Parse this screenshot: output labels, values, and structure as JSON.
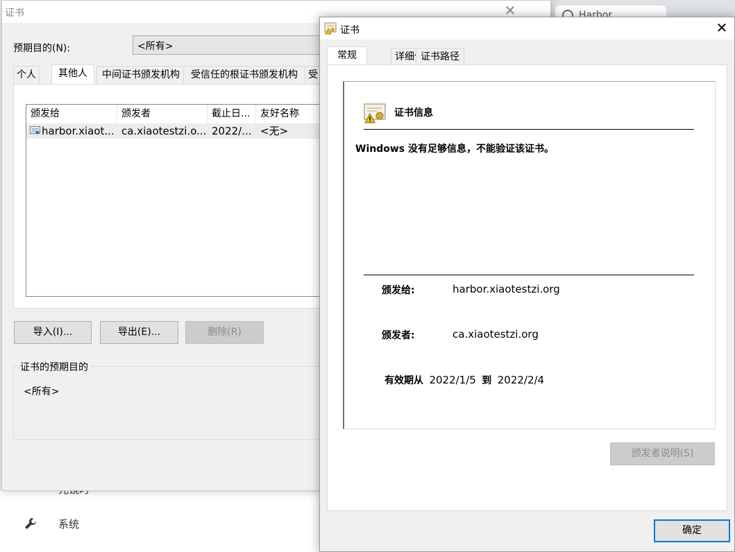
{
  "background": {
    "tabs": [
      {
        "label": "×",
        "icon": "close-icon"
      },
      {
        "label": "Harbor",
        "icon": "harbor-icon"
      }
    ],
    "partial_menu_text": "元镜时",
    "menu_system_label": "系统",
    "menu_system_icon": "wrench-icon"
  },
  "cert_manager": {
    "title": "证书",
    "close_label": "✕",
    "purpose_label": "预期目的(N):",
    "purpose_value": "<所有>",
    "tabs": [
      "个人",
      "其他人",
      "中间证书颁发机构",
      "受信任的根证书颁发机构",
      "受"
    ],
    "selected_tab": "其他人",
    "list": {
      "columns": [
        "颁发给",
        "颁发者",
        "截止日...",
        "友好名称"
      ],
      "rows": [
        {
          "issued_to": "harbor.xiaot...",
          "issued_by": "ca.xiaotestzi.o...",
          "expires": "2022/...",
          "friendly_name": "<无>"
        }
      ]
    },
    "buttons": {
      "import": "导入(I)...",
      "export": "导出(E)...",
      "remove": "删除(R)"
    },
    "purposes_group_title": "证书的预期目的",
    "purposes_value": "<所有>"
  },
  "cert_dialog": {
    "title": "证书",
    "close_label": "✕",
    "tabs": [
      "常规",
      "详细信息",
      "证书路径"
    ],
    "selected_tab": "常规",
    "info_title": "证书信息",
    "warning": "Windows 没有足够信息，不能验证该证书。",
    "issued_to_label": "颁发给:",
    "issued_to_value": "harbor.xiaotestzi.org",
    "issued_by_label": "颁发者:",
    "issued_by_value": "ca.xiaotestzi.org",
    "valid_from_label": "有效期从",
    "valid_from": "2022/1/5",
    "valid_to_label": "到",
    "valid_to": "2022/2/4",
    "issuer_statement_button": "颁发者说明(S)",
    "ok_button": "确定"
  }
}
